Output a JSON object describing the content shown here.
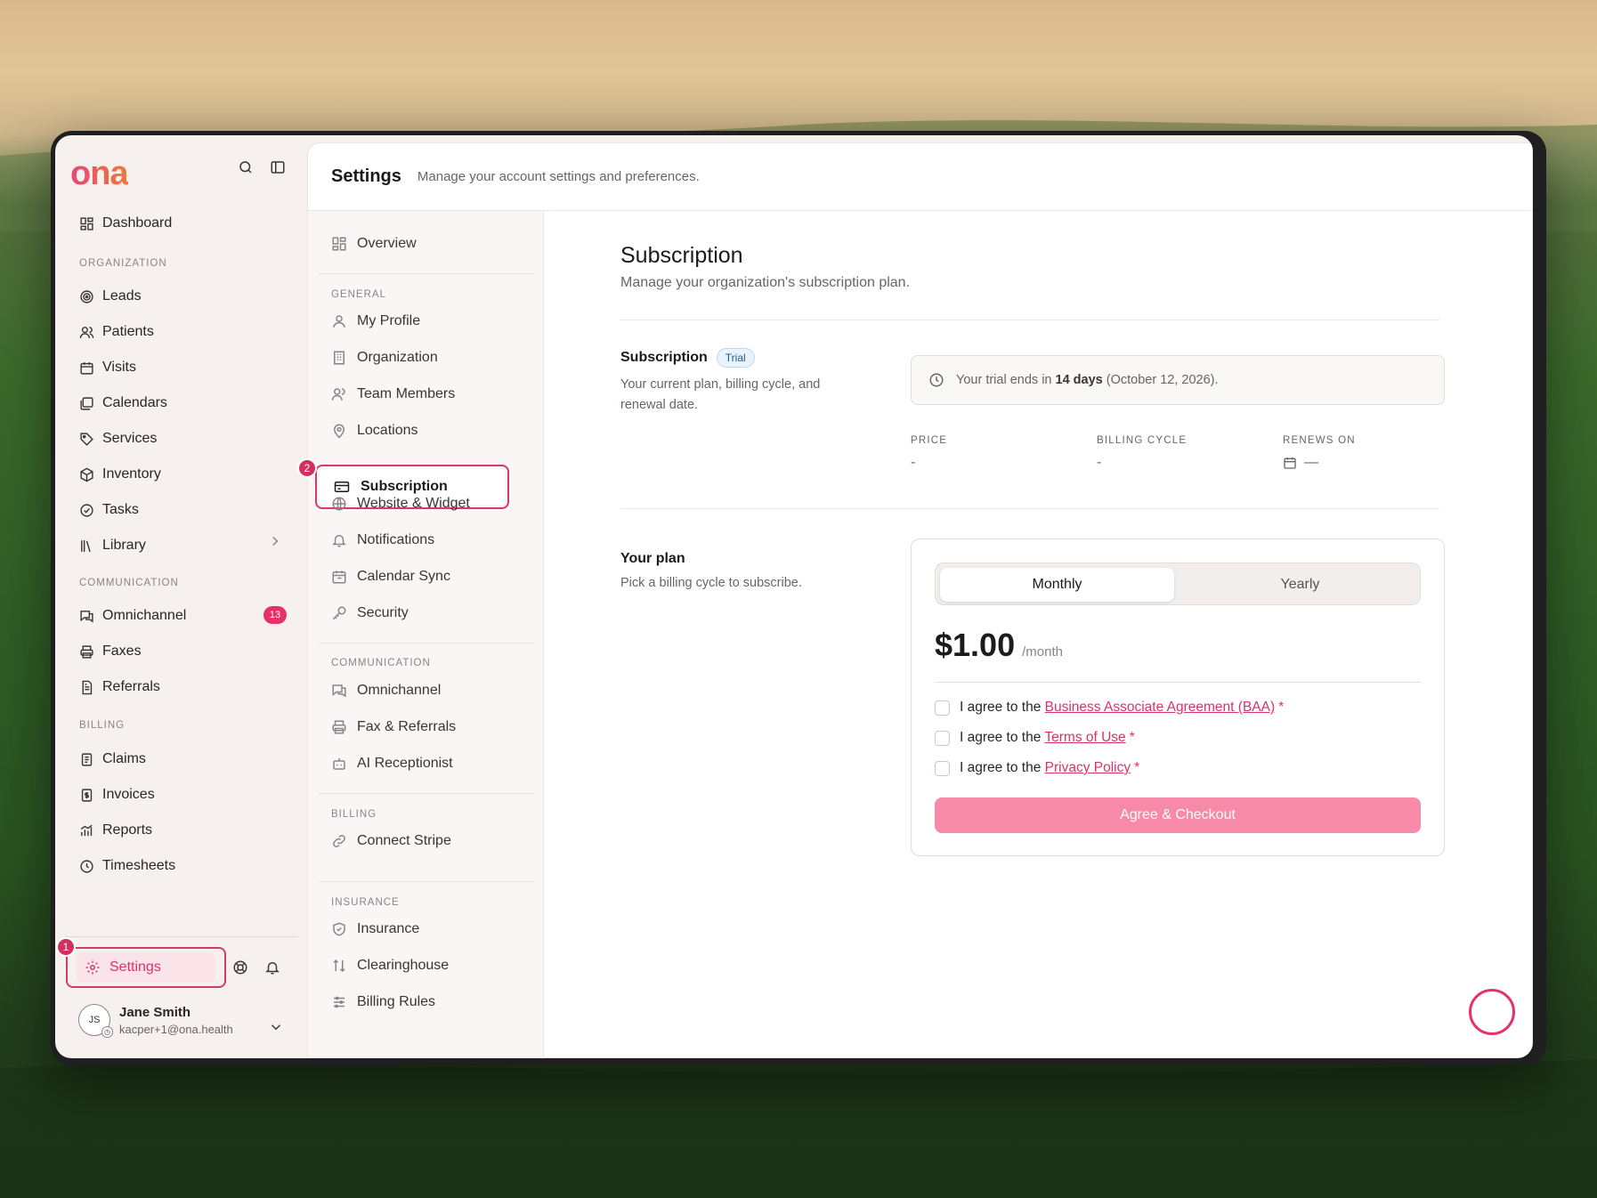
{
  "app": {
    "logo": "ona"
  },
  "sidebar": {
    "dashboard": "Dashboard",
    "sections": {
      "organization": "ORGANIZATION",
      "communication": "COMMUNICATION",
      "billing": "BILLING"
    },
    "organization_items": [
      "Leads",
      "Patients",
      "Visits",
      "Calendars",
      "Services",
      "Inventory",
      "Tasks",
      "Library"
    ],
    "communication_items": [
      "Omnichannel",
      "Faxes",
      "Referrals"
    ],
    "omnichannel_badge": "13",
    "billing_items": [
      "Claims",
      "Invoices",
      "Reports",
      "Timesheets"
    ],
    "settings_label": "Settings",
    "marker_settings": "1",
    "user": {
      "initials": "JS",
      "name": "Jane Smith",
      "email": "kacper+1@ona.health"
    }
  },
  "header": {
    "title": "Settings",
    "subtitle": "Manage your account settings and preferences."
  },
  "subnav": {
    "overview": "Overview",
    "sections": {
      "general": "GENERAL",
      "communication": "COMMUNICATION",
      "billing": "BILLING",
      "insurance": "INSURANCE"
    },
    "general_items": [
      "My Profile",
      "Organization",
      "Team Members",
      "Locations",
      "Subscription",
      "Website & Widget",
      "Notifications",
      "Calendar Sync",
      "Security"
    ],
    "communication_items": [
      "Omnichannel",
      "Fax & Referrals",
      "AI Receptionist"
    ],
    "billing_items": [
      "Connect Stripe"
    ],
    "insurance_items": [
      "Insurance",
      "Clearinghouse",
      "Billing Rules"
    ],
    "marker_subscription": "2",
    "active": "Subscription"
  },
  "content": {
    "title": "Subscription",
    "subtitle": "Manage your organization's subscription plan.",
    "subscription_section": {
      "title": "Subscription",
      "badge": "Trial",
      "description": "Your current plan, billing cycle, and renewal date.",
      "trial_prefix": "Your trial ends in",
      "trial_days": "14 days",
      "trial_date": "(October 12, 2026).",
      "price_label": "PRICE",
      "price_value": "-",
      "cycle_label": "BILLING CYCLE",
      "cycle_value": "-",
      "renews_label": "RENEWS ON",
      "renews_value": "—"
    },
    "plan_section": {
      "title": "Your plan",
      "description": "Pick a billing cycle to subscribe.",
      "toggle": {
        "monthly": "Monthly",
        "yearly": "Yearly",
        "selected": "Monthly"
      },
      "price": "$1.00",
      "per": "/month",
      "agree_prefix": "I agree to the",
      "agreements": [
        "Business Associate Agreement (BAA)",
        "Terms of Use",
        "Privacy Policy"
      ],
      "required_mark": "*",
      "checkout_label": "Agree & Checkout"
    }
  },
  "colors": {
    "accent": "#d6336c",
    "checkout_bg": "#f78aa8",
    "marker": "#d2305f"
  }
}
